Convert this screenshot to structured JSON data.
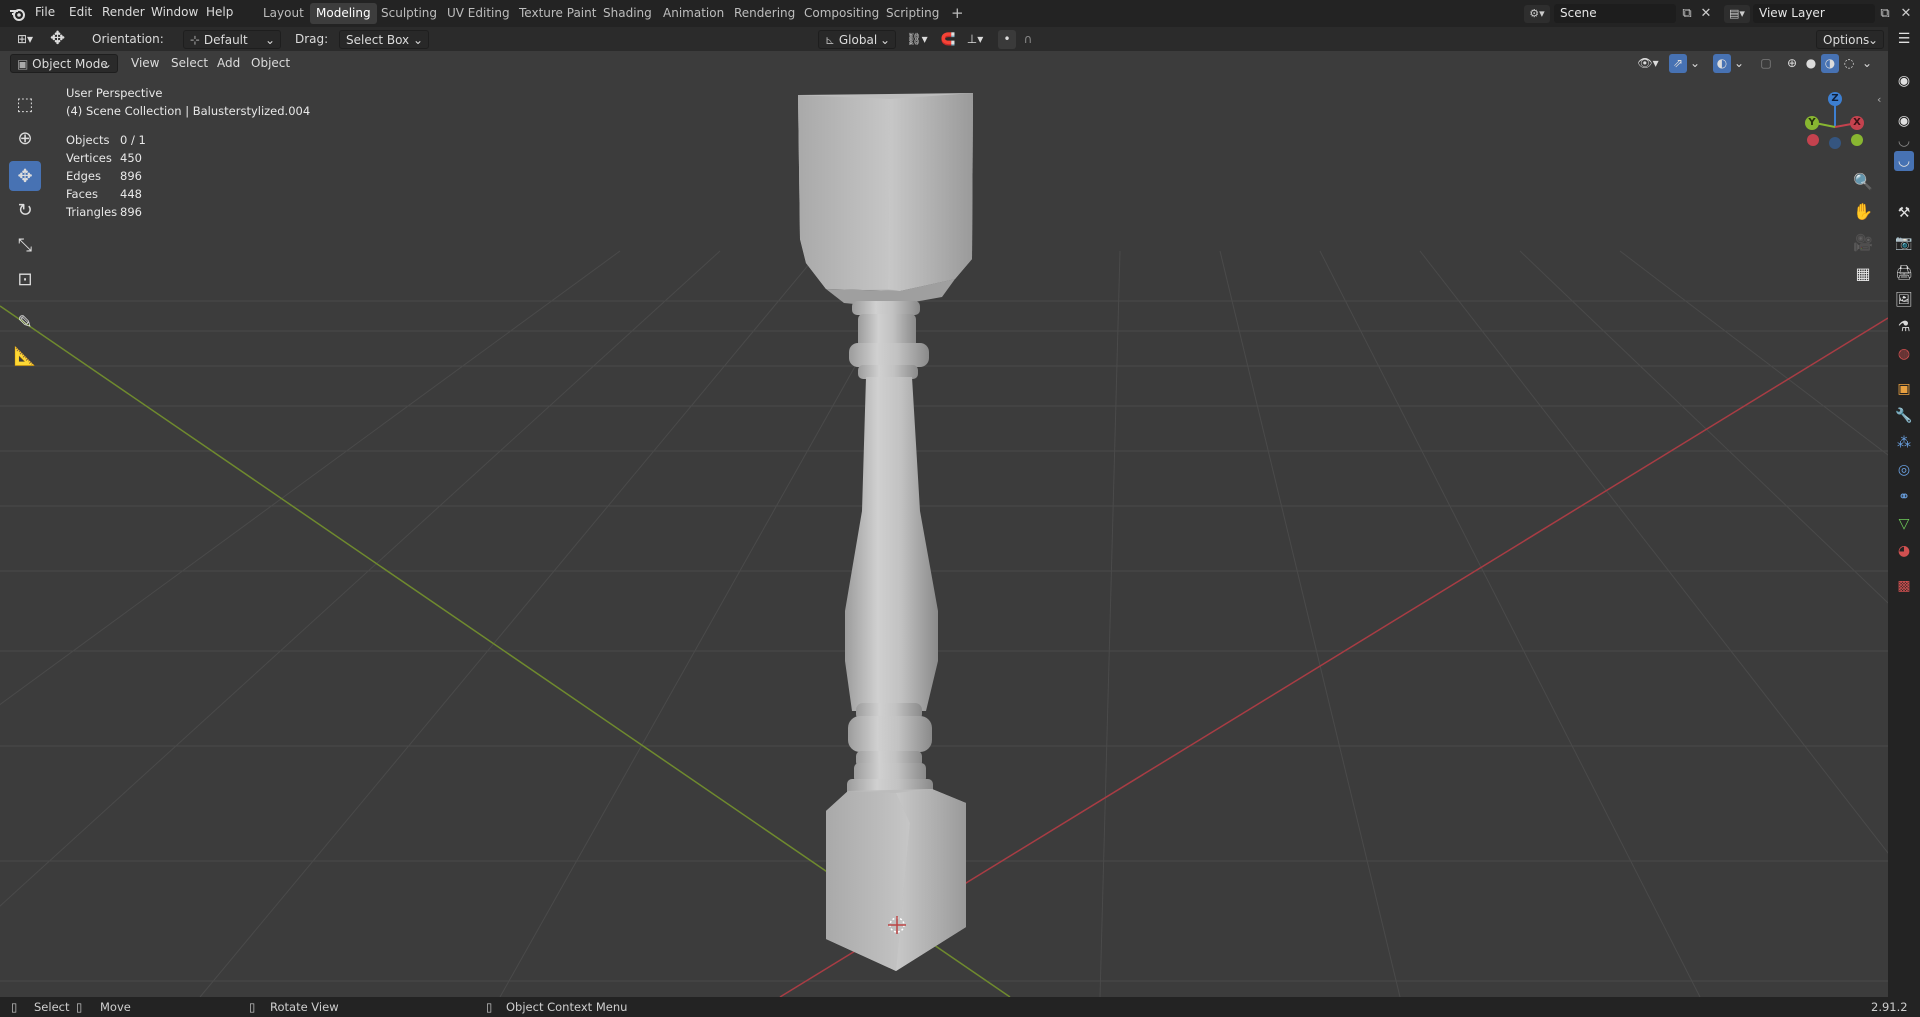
{
  "menu": {
    "items": [
      "File",
      "Edit",
      "Render",
      "Window",
      "Help"
    ]
  },
  "workspaces": [
    "Layout",
    "Modeling",
    "Sculpting",
    "UV Editing",
    "Texture Paint",
    "Shading",
    "Animation",
    "Rendering",
    "Compositing",
    "Scripting"
  ],
  "active_workspace": "Modeling",
  "add_workspace_label": "+",
  "scene": {
    "name": "Scene",
    "view_layer": "View Layer"
  },
  "header": {
    "orientation_label": "Orientation:",
    "orientation_value": "Default",
    "drag_label": "Drag:",
    "drag_value": "Select Box",
    "transform_orientation": "Global",
    "options_label": "Options"
  },
  "viewport_header": {
    "mode": "Object Mode",
    "menus": [
      "View",
      "Select",
      "Add",
      "Object"
    ]
  },
  "overlay": {
    "perspective": "User Perspective",
    "collection": "(4) Scene Collection | Balusterstylized.004",
    "stats": [
      {
        "label": "Objects",
        "value": "0 / 1"
      },
      {
        "label": "Vertices",
        "value": "450"
      },
      {
        "label": "Edges",
        "value": "896"
      },
      {
        "label": "Faces",
        "value": "448"
      },
      {
        "label": "Triangles",
        "value": "896"
      }
    ]
  },
  "gizmo": {
    "x": "X",
    "y": "Y",
    "z": "Z"
  },
  "statusbar": {
    "select": "Select",
    "move": "Move",
    "rotate": "Rotate View",
    "context": "Object Context Menu",
    "version": "2.91.2"
  },
  "colors": {
    "accent": "#4772b3",
    "axis_x": "#c4424e",
    "axis_y": "#88b631",
    "axis_z": "#3d7fd1",
    "viewport_bg": "#3c3c3c",
    "grid": "#4a4a4a"
  },
  "icons": {
    "blender_logo": "blender-logo-icon",
    "select_box": "select-box-icon",
    "cursor": "cursor-icon",
    "move": "move-icon",
    "rotate": "rotate-icon",
    "scale": "scale-icon",
    "transform": "transform-icon",
    "annotate": "annotate-icon",
    "measure": "measure-icon"
  }
}
